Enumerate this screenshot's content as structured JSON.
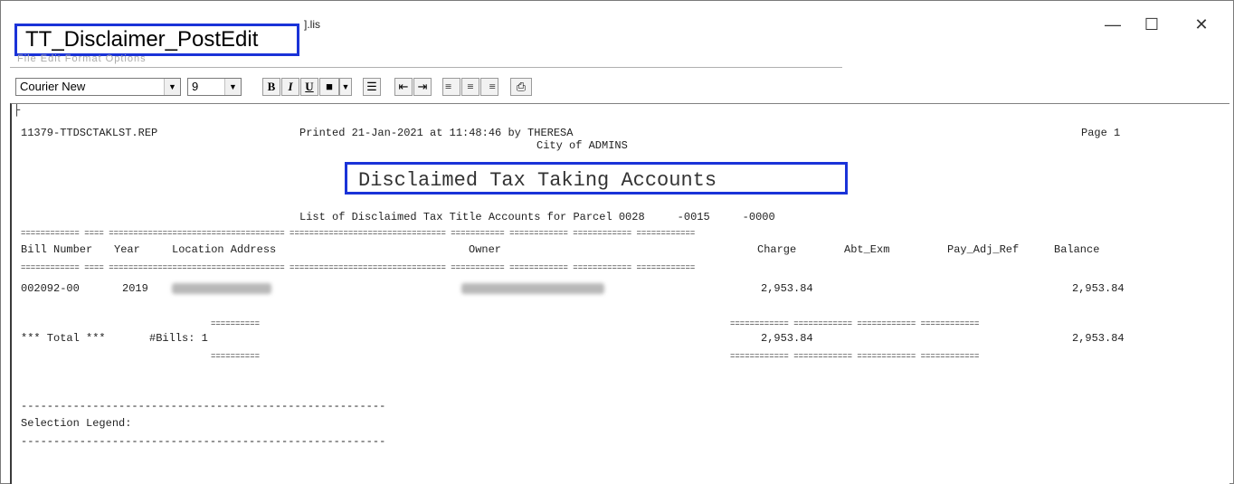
{
  "window": {
    "title_partial": "].lis",
    "title_overlay": "TT_Disclaimer_PostEdit",
    "menu_ghost": "File  Edit  Format  Options",
    "controls": {
      "minimize": "—",
      "maximize": "☐",
      "close": "✕"
    }
  },
  "toolbar": {
    "font_name": "Courier New",
    "font_size": "9",
    "bold": "B",
    "italic": "I",
    "underline": "U",
    "color_glyph": "■",
    "bullets_glyph": "☰",
    "outdent_glyph": "⇤",
    "indent_glyph": "⇥",
    "align_left_glyph": "≡",
    "align_center_glyph": "≡",
    "align_right_glyph": "≡",
    "print_glyph": "⎙"
  },
  "report": {
    "cursor": "├",
    "report_id": "11379-TTDSCTAKLST.REP",
    "printed_line": "Printed 21-Jan-2021 at 11:48:46 by THERESA",
    "page": "Page 1",
    "city": "City of ADMINS",
    "heading": "Disclaimed Tax Taking Accounts",
    "subtitle": "List of Disclaimed Tax Title Accounts for Parcel 0028     -0015     -0000",
    "rule_line": "============ ==== ==================================== ================================ =========== ============ ============ ============",
    "columns": {
      "bill_number": "Bill Number",
      "year": "Year",
      "location": "Location Address",
      "owner": "Owner",
      "charge": "Charge",
      "abt_exm": "Abt_Exm",
      "pay_adj_ref": "Pay_Adj_Ref",
      "balance": "Balance"
    },
    "row": {
      "bill_number": "002092-00",
      "year": "2019",
      "charge": "2,953.84",
      "balance": "2,953.84"
    },
    "total_short_rule": "==========",
    "total_long_rule": "============ ============ ============ ============",
    "total": {
      "label": "*** Total ***",
      "bills": "#Bills: 1",
      "charge": "2,953.84",
      "balance": "2,953.84"
    },
    "dash_line": "--------------------------------------------------------",
    "selection_legend": "Selection Legend:"
  },
  "colors": {
    "highlight_border": "#1a33d8"
  }
}
